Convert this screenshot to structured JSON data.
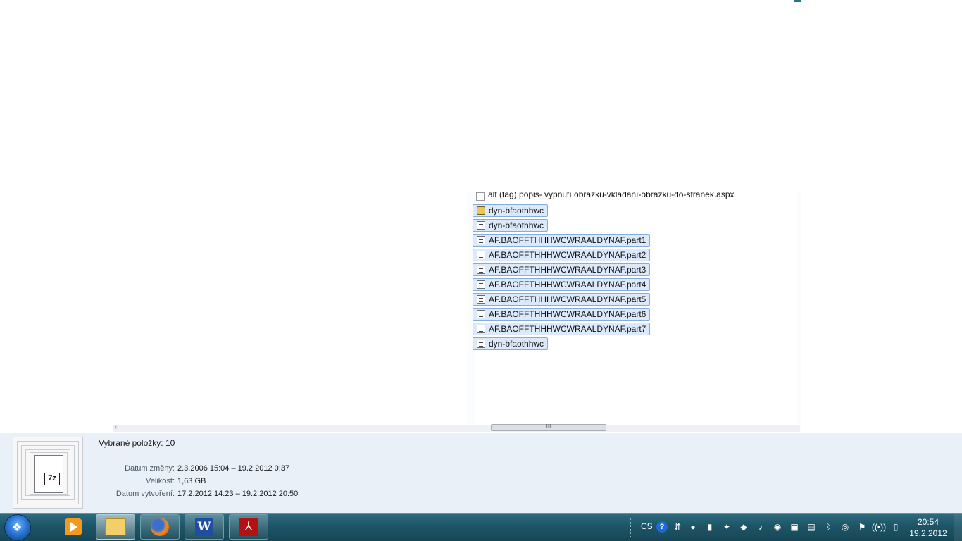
{
  "file_list": {
    "items": [
      {
        "name": "alt (tag) popis- vypnutí obrázku-vkládání-obrázku-do-stránek.aspx",
        "icon": "blank-file-icon",
        "selected": false
      },
      {
        "name": "dyn-bfaothhwc",
        "icon": "archive-file-icon",
        "selected": true
      },
      {
        "name": "dyn-bfaothhwc",
        "icon": "image-file-icon",
        "selected": true
      },
      {
        "name": "AF.BAOFFTHHHWCWRAALDYNAF.part1",
        "icon": "image-file-icon",
        "selected": true
      },
      {
        "name": "AF.BAOFFTHHHWCWRAALDYNAF.part2",
        "icon": "image-file-icon",
        "selected": true
      },
      {
        "name": "AF.BAOFFTHHHWCWRAALDYNAF.part3",
        "icon": "image-file-icon",
        "selected": true
      },
      {
        "name": "AF.BAOFFTHHHWCWRAALDYNAF.part4",
        "icon": "image-file-icon",
        "selected": true
      },
      {
        "name": "AF.BAOFFTHHHWCWRAALDYNAF.part5",
        "icon": "image-file-icon",
        "selected": true
      },
      {
        "name": "AF.BAOFFTHHHWCWRAALDYNAF.part6",
        "icon": "image-file-icon",
        "selected": true
      },
      {
        "name": "AF.BAOFFTHHHWCWRAALDYNAF.part7",
        "icon": "image-file-icon",
        "selected": true
      },
      {
        "name": "dyn-bfaothhwc",
        "icon": "image-file-icon",
        "selected": true
      }
    ]
  },
  "scrollbar": {
    "thumb_grip": "III"
  },
  "details": {
    "file_badge": "7z",
    "selected_count": "Vybrané položky: 10",
    "modified_label": "Datum změny:",
    "modified_value": "2.3.2006 15:04 – 19.2.2012 0:37",
    "size_label": "Velikost:",
    "size_value": "1,63 GB",
    "created_label": "Datum vytvoření:",
    "created_value": "17.2.2012 14:23 – 19.2.2012 20:50"
  },
  "taskbar": {
    "pinned": [
      {
        "name": "media-player-icon"
      },
      {
        "name": "explorer-folder-icon"
      },
      {
        "name": "firefox-icon"
      },
      {
        "name": "word-icon",
        "glyph": "W"
      },
      {
        "name": "acrobat-icon",
        "glyph": "⅄"
      }
    ],
    "language": "CS",
    "help_glyph": "?",
    "clock_time": "20:54",
    "clock_date": "19.2.2012"
  }
}
